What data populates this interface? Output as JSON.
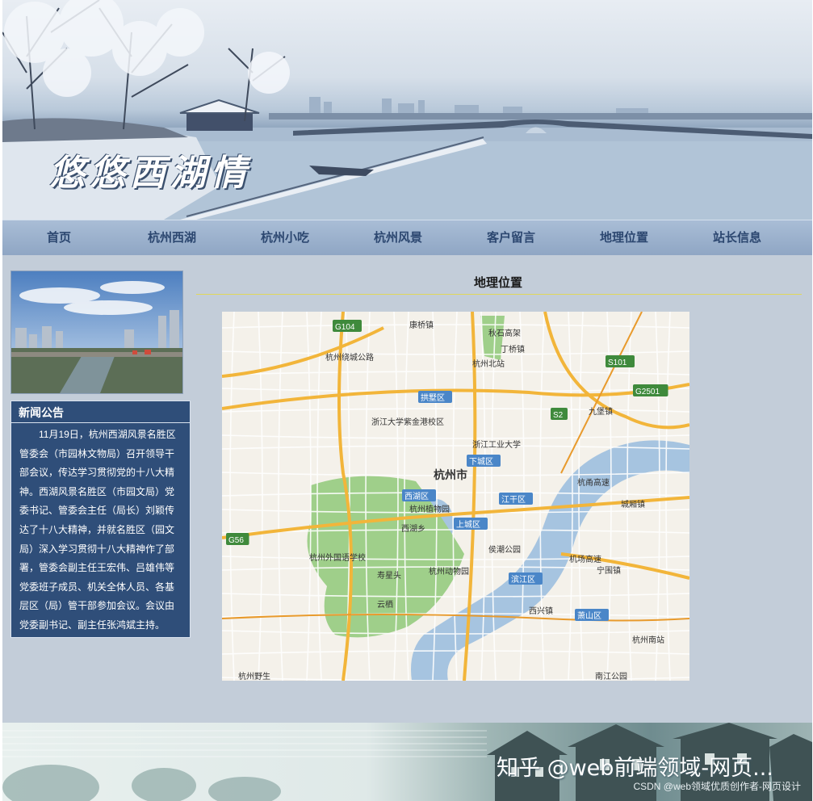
{
  "banner": {
    "title": "悠悠西湖情"
  },
  "nav": {
    "items": [
      "首页",
      "杭州西湖",
      "杭州小吃",
      "杭州风景",
      "客户留言",
      "地理位置",
      "站长信息"
    ]
  },
  "news": {
    "title": "新闻公告",
    "body": "11月19日，杭州西湖风景名胜区管委会（市园林文物局）召开领导干部会议，传达学习贯彻党的十八大精神。西湖风景名胜区（市园文局）党委书记、管委会主任（局长）刘颖传达了十八大精神，并就名胜区（园文局）深入学习贯彻十八大精神作了部署，管委会副主任王宏伟、吕雄伟等党委班子成员、机关全体人员、各基层区（局）管干部参加会议。会议由党委副书记、副主任张鸿斌主持。"
  },
  "main": {
    "title": "地理位置"
  },
  "map": {
    "labels": [
      "康桥镇",
      "丁桥镇",
      "杭州北站",
      "拱墅区",
      "浙江大学紫金港校区",
      "浙江工业大学",
      "下城区",
      "杭州市",
      "西湖区",
      "杭州植物园",
      "江干区",
      "上城区",
      "西湖乡",
      "杭州外国语学校",
      "侯潮公园",
      "寿星头",
      "杭州动物园",
      "滨江区",
      "云栖",
      "西兴镇",
      "萧山区",
      "杭州南站",
      "九堡镇",
      "城厢镇",
      "宁围镇",
      "南江公园",
      "杭州野生",
      "杭州绕城公路",
      "机场高速",
      "杭甬高速",
      "秋石高架",
      "G104",
      "S101",
      "G2501",
      "S2",
      "G56"
    ]
  },
  "footer": {
    "watermark": "知乎 @web前端领域-网页...",
    "credit": "CSDN @web领域优质创作者-网页设计"
  }
}
